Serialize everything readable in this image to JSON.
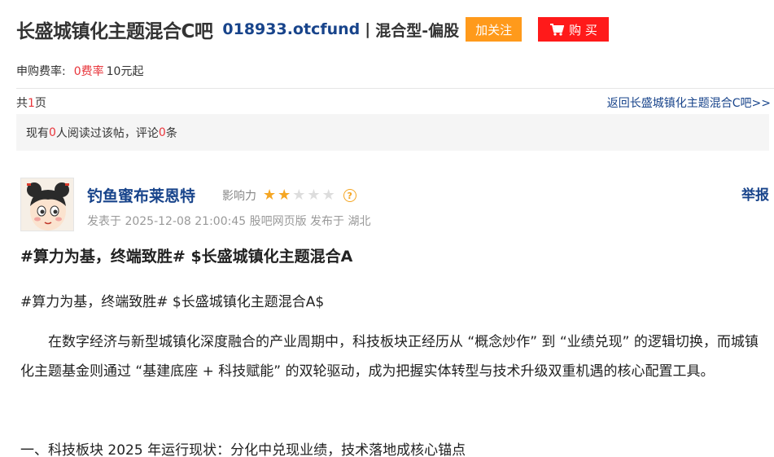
{
  "header": {
    "bar_name": "长盛城镇化主题混合C吧",
    "fund_code": "018933.otcfund",
    "separator": "|",
    "fund_type": "混合型-偏股",
    "follow_label": "加关注",
    "buy_label": "购 买"
  },
  "fee": {
    "label": "申购费率:",
    "rate": "0费率",
    "minimum": "10元起"
  },
  "pager": {
    "prefix": "共",
    "pages": "1",
    "suffix": "页",
    "back_link": "返回长盛城镇化主题混合C吧>>"
  },
  "stats": {
    "prefix": "现有",
    "readers": "0",
    "middle": "人阅读过该帖，评论",
    "comments": "0",
    "suffix": "条"
  },
  "author": {
    "name": "钓鱼蜜布莱恩特",
    "influence_label": "影响力",
    "influence_stars": 2,
    "influence_max": 5,
    "meta": "发表于 2025-12-08 21:00:45 股吧网页版 发布于 湖北",
    "report_label": "举报"
  },
  "post": {
    "title": "#算力为基，终端致胜# $长盛城镇化主题混合A",
    "topic_line": "#算力为基，终端致胜# $长盛城镇化主题混合A$",
    "paragraph": "在数字经济与新型城镇化深度融合的产业周期中，科技板块正经历从 “概念炒作” 到 “业绩兑现” 的逻辑切换，而城镇化主题基金则通过 “基建底座 + 科技赋能” 的双轮驱动，成为把握实体转型与技术升级双重机遇的核心配置工具。",
    "section_heading": "一、科技板块 2025 年运行现状：分化中兑现业绩，技术落地成核心锚点"
  },
  "colors": {
    "link_blue": "#18448b",
    "highlight_red": "#e8353b",
    "follow_orange": "#ff9a1b",
    "buy_red": "#ff1a1a",
    "star_gold": "#f5a623"
  },
  "icons": {
    "cart": "shopping-cart-icon",
    "help": "question-circle-icon",
    "star": "star-icon"
  }
}
